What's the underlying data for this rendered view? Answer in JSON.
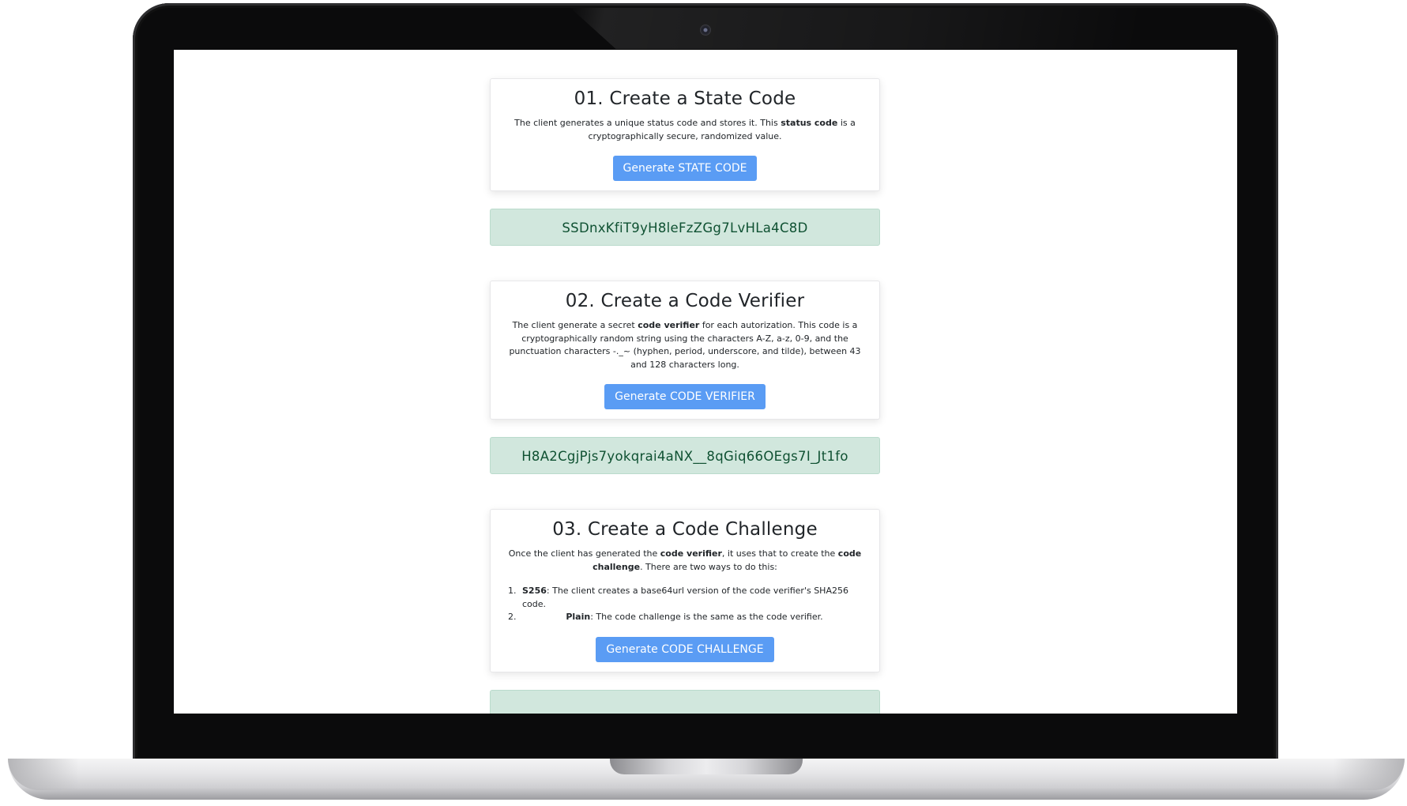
{
  "step1": {
    "title": "01. Create a State Code",
    "desc_before": "The client generates a unique status code and stores it. This ",
    "desc_bold": "status code",
    "desc_after": " is a cryptographically secure, randomized value.",
    "button": "Generate STATE CODE",
    "result": "SSDnxKfiT9yH8leFzZGg7LvHLa4C8D"
  },
  "step2": {
    "title": "02. Create a Code Verifier",
    "desc_before": "The client generate a secret ",
    "desc_bold": "code verifier",
    "desc_after": " for each autorization. This code is a cryptographically random string using the characters A-Z, a-z, 0-9, and the punctuation characters -._~ (hyphen, period, underscore, and tilde), between 43 and 128 characters long.",
    "button": "Generate CODE VERIFIER",
    "result": "H8A2CgjPjs7yokqrai4aNX__8qGiq66OEgs7I_Jt1fo"
  },
  "step3": {
    "title": "03. Create a Code Challenge",
    "desc_p1": "Once the client has generated the ",
    "desc_b1": "code verifier",
    "desc_p2": ", it uses that to create the ",
    "desc_b2": "code challenge",
    "desc_p3": ". There are two ways to do this:",
    "list": [
      {
        "bold": "S256",
        "text": ": The client creates a base64url version of the code verifier's SHA256 code."
      },
      {
        "bold": "Plain",
        "text": ": The code challenge is the same as the code verifier."
      }
    ],
    "button": "Generate CODE CHALLENGE"
  }
}
